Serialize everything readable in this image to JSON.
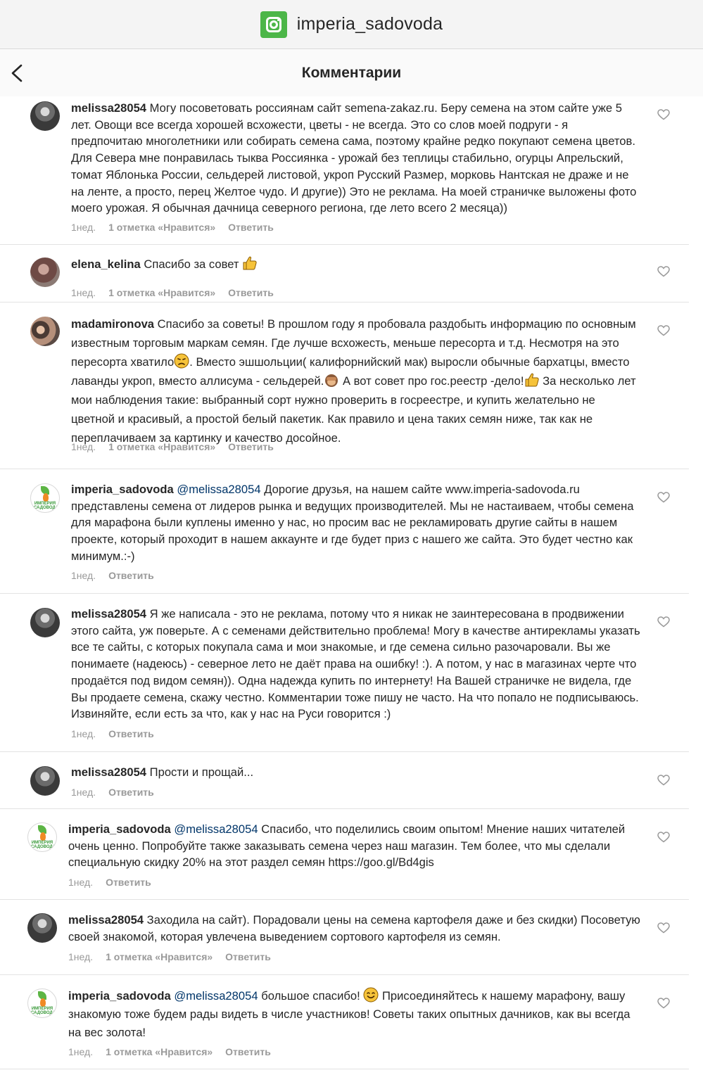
{
  "app": {
    "account": "imperia_sadovoda",
    "logo_icon": "instagram-icon",
    "accent_color": "#4cb648"
  },
  "nav": {
    "title": "Комментарии",
    "back_icon": "chevron-left-icon"
  },
  "comments": [
    {
      "user": "melissa28054",
      "text": "Могу посоветовать россиянам сайт semena-zakaz.ru. Беру семена на этом сайте уже 5 лет. Овощи все всегда хорошей всхожести, цветы - не всегда. Это со слов моей подруги - я предпочитаю многолетники или собирать семена сама, поэтому крайне редко покупают семена цветов. Для Севера мне понравилась тыква Россиянка - урожай без теплицы стабильно, огурцы Апрельский, томат Яблонька России, сельдерей листовой, укроп Русский Размер, морковь Нантская не драже и не на ленте, а просто, перец Желтое чудо. И другие)) Это не реклама. На моей страничке выложены фото моего урожая. Я обычная дачница северного региона, где лето всего 2 месяца))",
      "time": "1нед.",
      "likes": "1 отметка «Нравится»",
      "reply": "Ответить"
    },
    {
      "user": "elena_kelina",
      "text": "Спасибо за совет",
      "time": "1нед.",
      "likes": "1 отметка «Нравится»",
      "reply": "Ответить"
    },
    {
      "user": "madamironova",
      "text_1": "Спасибо за советы! В прошлом году я пробовала раздобыть информацию по основным известным торговым маркам семян. Где лучше всхожесть, меньше пересорта и т.д. Несмотря на это пересорта хватило",
      "text_2": ". Вместо эшшольции( калифорнийский мак) выросли обычные бархатцы, вместо лаванды укроп, вместо аллисума - сельдерей.",
      "text_3": " А вот совет про гос.реестр -дело!",
      "text_4": " За несколько лет мои наблюдения такие: выбранный сорт нужно проверить в госреестре, и купить желательно не цветной и красивый, а простой белый пакетик. Как правило и цена таких семян ниже, так как не переплачиваем за картинку и качество досойное.",
      "time": "1нед.",
      "likes": "1 отметка «Нравится»",
      "reply": "Ответить"
    },
    {
      "user": "imperia_sadovoda",
      "mention": "@melissa28054",
      "text": "Дорогие друзья, на нашем сайте www.imperia-sadovoda.ru представлены семена от лидеров рынка и ведущих производителей. Мы не настаиваем, чтобы семена для марафона были куплены именно у нас, но просим вас не рекламировать другие сайты в нашем проекте, который проходит в нашем аккаунте и где будет приз с нашего же сайта. Это будет честно как минимум.:-)",
      "time": "1нед.",
      "reply": "Ответить"
    },
    {
      "user": "melissa28054",
      "text": "Я же написала - это не реклама, потому что я никак не заинтересована в продвижении этого сайта, уж поверьте. А с семенами действительно проблема! Могу в качестве антирекламы указать все те сайты, с которых покупала сама и мои знакомые, и где семена сильно разочаровали. Вы же понимаете (надеюсь) - северное лето не даёт права на ошибку! :). А потом, у нас в магазинах черте что продаётся под видом семян)). Одна надежда купить по интернету! На Вашей страничке не видела, где Вы продаете семена, скажу честно. Комментарии тоже пишу не часто. На что попало не подписываюсь. Извиняйте, если есть за что, как у нас на Руси говорится :)",
      "time": "1нед.",
      "reply": "Ответить"
    },
    {
      "user": "melissa28054",
      "text": "Прости и прощай...",
      "time": "1нед.",
      "reply": "Ответить"
    },
    {
      "user": "imperia_sadovoda",
      "mention": "@melissa28054",
      "text": "Спасибо, что поделились своим опытом! Мнение наших читателей очень ценно. Попробуйте также заказывать семена через наш магазин. Тем более, что мы сделали специальную скидку 20% на этот раздел семян https://goo.gl/Bd4gis",
      "time": "1нед.",
      "reply": "Ответить"
    },
    {
      "user": "melissa28054",
      "text": "Заходила на сайт). Порадовали цены на семена картофеля даже и без скидки) Посоветую своей знакомой, которая увлечена выведением сортового картофеля из семян.",
      "time": "1нед.",
      "likes": "1 отметка «Нравится»",
      "reply": "Ответить"
    },
    {
      "user": "imperia_sadovoda",
      "mention": "@melissa28054",
      "text_1": "большое спасибо!",
      "text_2": " Присоединяйтесь к нашему марафону, вашу знакомую тоже будем рады видеть в числе участников! Советы таких опытных дачников, как вы всегда на вес золота!",
      "time": "1нед.",
      "likes": "1 отметка «Нравится»",
      "reply": "Ответить"
    }
  ],
  "brand_avatar_text": "ИМПЕРИЯ САДОВОДА",
  "icons": {
    "heart": "heart-outline-icon",
    "thumbs_up": "thumbs-up-emoji-icon",
    "confused": "confused-face-emoji-icon",
    "monkey": "see-no-evil-monkey-emoji-icon",
    "smile": "smiling-face-emoji-icon"
  }
}
